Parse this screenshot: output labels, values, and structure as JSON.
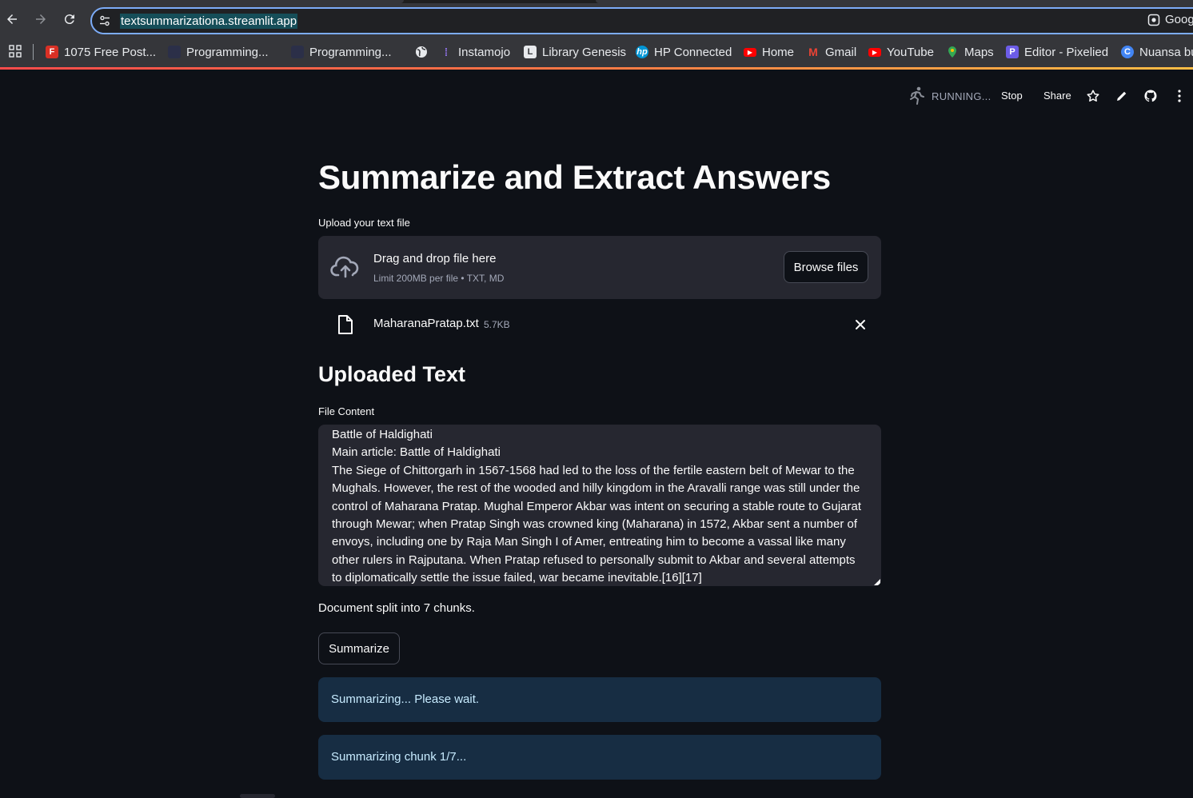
{
  "browser": {
    "url": "textsummarizationa.streamlit.app",
    "google_button": "Goog",
    "bookmarks": [
      {
        "label": "1075 Free Post...",
        "icon": "f-icon",
        "color": "#d93025"
      },
      {
        "label": "Programming...",
        "icon": "globe-icon",
        "color": "#202124"
      },
      {
        "label": "Programming...",
        "icon": "globe-icon",
        "color": "#202124"
      },
      {
        "label": "",
        "icon": "globe-icon",
        "color": "#e8eaed"
      },
      {
        "label": "Instamojo",
        "icon": "instamojo-icon",
        "color": "#6b4fbb"
      },
      {
        "label": "Library Genesis",
        "icon": "book-icon",
        "color": "#e8eaed"
      },
      {
        "label": "HP Connected",
        "icon": "hp-icon",
        "color": "#0096d6"
      },
      {
        "label": "Home",
        "icon": "youtube-icon",
        "color": "#ff0000"
      },
      {
        "label": "Gmail",
        "icon": "gmail-icon",
        "color": "#ea4335"
      },
      {
        "label": "YouTube",
        "icon": "youtube-icon",
        "color": "#ff0000"
      },
      {
        "label": "Maps",
        "icon": "maps-icon",
        "color": "#34a853"
      },
      {
        "label": "Editor - Pixelied",
        "icon": "pixelied-icon",
        "color": "#6c5ce7"
      },
      {
        "label": "Nuansa bu",
        "icon": "nuansa-icon",
        "color": "#4285f4"
      }
    ]
  },
  "header": {
    "status": "RUNNING...",
    "stop": "Stop",
    "share": "Share"
  },
  "main": {
    "title": "Summarize and Extract Answers",
    "upload_label": "Upload your text file",
    "dropzone_title": "Drag and drop file here",
    "dropzone_limit": "Limit 200MB per file • TXT, MD",
    "browse_button": "Browse files",
    "file_name": "MaharanaPratap.txt",
    "file_size": "5.7KB",
    "uploaded_heading": "Uploaded Text",
    "file_content_label": "File Content",
    "file_content_lines": [
      "Battle of Haldighati",
      "Main article: Battle of Haldighati",
      "The Siege of Chittorgarh in 1567-1568 had led to the loss of the fertile eastern belt of Mewar to the",
      "Mughals. However, the rest of the wooded and hilly kingdom in the Aravalli range was still under the",
      "control of Maharana Pratap. Mughal Emperor Akbar was intent on securing a stable route to Gujarat",
      "through Mewar; when Pratap Singh was crowned king (Maharana) in 1572, Akbar sent a number of",
      "envoys, including one by Raja Man Singh I of Amer, entreating him to become a vassal like many",
      "other rulers in Rajputana. When Pratap refused to personally submit to Akbar and several attempts",
      "to diplomatically settle the issue failed, war became inevitable.[16][17]"
    ],
    "chunks_text": "Document split into 7 chunks.",
    "summarize_button": "Summarize",
    "info_1": "Summarizing... Please wait.",
    "info_2": "Summarizing chunk 1/7..."
  }
}
